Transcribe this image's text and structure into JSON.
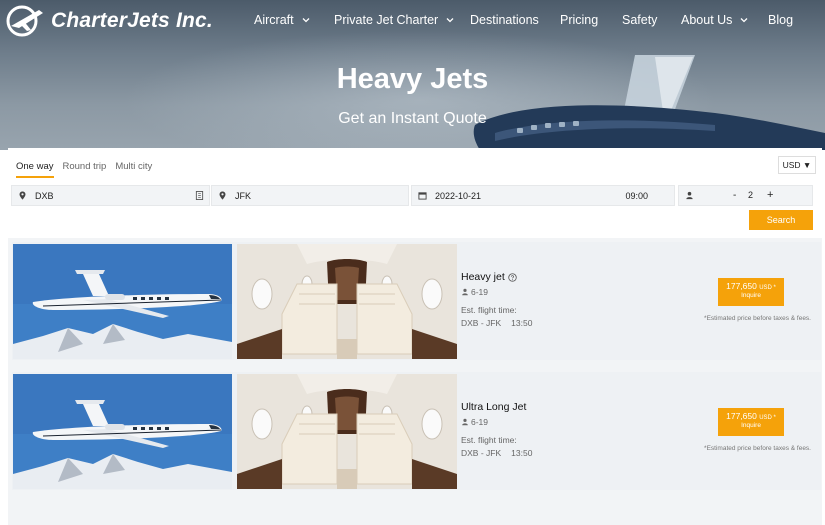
{
  "brand": {
    "name": "CharterJets Inc."
  },
  "nav": {
    "items": [
      {
        "label": "Aircraft",
        "dropdown": true
      },
      {
        "label": "Private Jet Charter",
        "dropdown": true
      },
      {
        "label": "Destinations",
        "dropdown": false
      },
      {
        "label": "Pricing",
        "dropdown": false
      },
      {
        "label": "Safety",
        "dropdown": false
      },
      {
        "label": "About Us",
        "dropdown": true
      },
      {
        "label": "Blog",
        "dropdown": false
      }
    ]
  },
  "hero": {
    "title": "Heavy Jets",
    "subtitle": "Get an Instant Quote"
  },
  "search": {
    "trip_types": [
      "One way",
      "Round trip",
      "Multi city"
    ],
    "active_trip_type": "One way",
    "currency": "USD ▼",
    "from": "DXB",
    "to": "JFK",
    "date": "2022-10-21",
    "time": "09:00",
    "passengers": "2",
    "minus": "-",
    "plus": "+",
    "button_label": "Search"
  },
  "results": [
    {
      "name": "Heavy jet",
      "pax": "6-19",
      "est_label": "Est. flight time:",
      "route": "DXB - JFK",
      "duration": "13:50",
      "price": "177,650",
      "currency": "USD *",
      "inquire": "Inquire",
      "note": "*Estimated price before taxes & fees."
    },
    {
      "name": "Ultra Long Jet",
      "pax": "6-19",
      "est_label": "Est. flight time:",
      "route": "DXB - JFK",
      "duration": "13:50",
      "price": "177,650",
      "currency": "USD *",
      "inquire": "Inquire",
      "note": "*Estimated price before taxes & fees."
    }
  ],
  "colors": {
    "accent": "#f5a20a",
    "hero_dark": "#4c5b6a",
    "panel_bg": "#f2f4f6"
  }
}
